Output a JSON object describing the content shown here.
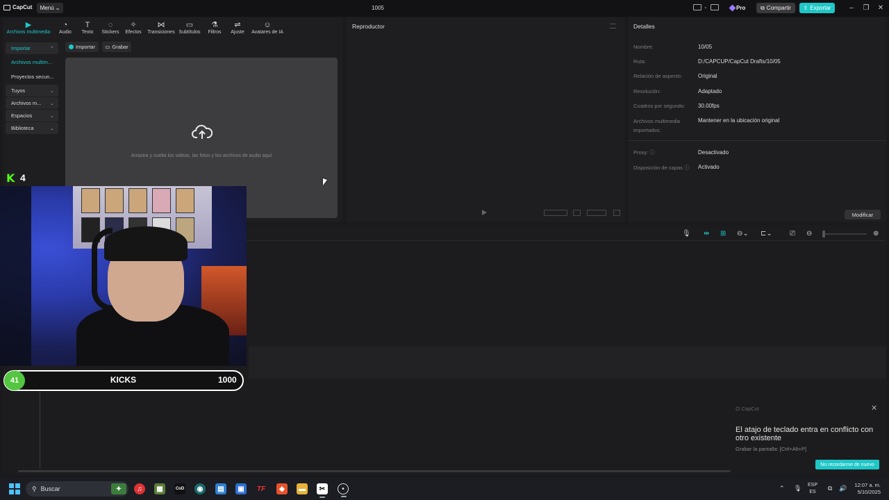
{
  "titlebar": {
    "brand": "CapCut",
    "menu_label": "Menú",
    "project_title": "1005",
    "pro_label": "Pro",
    "share_label": "Compartir",
    "export_label": "Exportar"
  },
  "tool_tabs": [
    {
      "label": "Archivos multimedia",
      "icon": "media-icon",
      "glyph": "▶"
    },
    {
      "label": "Audio",
      "icon": "audio-icon",
      "glyph": "◔"
    },
    {
      "label": "Texto",
      "icon": "text-icon",
      "glyph": "T"
    },
    {
      "label": "Stickers",
      "icon": "sticker-icon",
      "glyph": "◌"
    },
    {
      "label": "Efectos",
      "icon": "effects-icon",
      "glyph": "✧"
    },
    {
      "label": "Transiciones",
      "icon": "transitions-icon",
      "glyph": "⋈"
    },
    {
      "label": "Subtítulos",
      "icon": "subtitles-icon",
      "glyph": "▭"
    },
    {
      "label": "Filtros",
      "icon": "filters-icon",
      "glyph": "⚗"
    },
    {
      "label": "Ajuste",
      "icon": "adjust-icon",
      "glyph": "⇌"
    },
    {
      "label": "Avatares de IA",
      "icon": "ai-avatar-icon",
      "glyph": "☺"
    }
  ],
  "sidebar": {
    "items": [
      {
        "label": "Importar",
        "chevron": "⌃"
      },
      {
        "label": "Archivos multim...",
        "chevron": ""
      },
      {
        "label": "Proyectos secun...",
        "chevron": ""
      },
      {
        "label": "Tuyos",
        "chevron": "⌄"
      },
      {
        "label": "Archivos m...",
        "chevron": "⌄"
      },
      {
        "label": "Espacios",
        "chevron": "⌄"
      },
      {
        "label": "Biblioteca",
        "chevron": "⌄"
      }
    ]
  },
  "media": {
    "import_label": "Importar",
    "record_label": "Grabar",
    "dropzone_text": "Arrastra y suelta los videos, las fotos y los archivos de audio aquí"
  },
  "player": {
    "title": "Reproductor"
  },
  "details": {
    "title": "Detalles",
    "rows": [
      {
        "label": "Nombre:",
        "value": "10/05"
      },
      {
        "label": "Ruta:",
        "value": "D:/CAPCUP/CapCut Drafts/10/05"
      },
      {
        "label": "Relación de aspecto:",
        "value": "Original"
      },
      {
        "label": "Resolución:",
        "value": "Adaptado"
      },
      {
        "label": "Cuadros por segundo:",
        "value": "30.00fps"
      },
      {
        "label": "Archivos multimedia importados:",
        "value": "Mantener en la ubicación original"
      }
    ],
    "rows2": [
      {
        "label": "Proxy: ⓘ",
        "value": "Desactivado"
      },
      {
        "label": "Disposición de capas ⓘ",
        "value": "Activado"
      }
    ],
    "modify_label": "Modificar"
  },
  "overlay": {
    "kick_count": "4",
    "kicks_badge": "41",
    "kicks_label": "KICKS",
    "kicks_goal": "1000"
  },
  "toast": {
    "brand": "CapCut",
    "message": "El atajo de teclado entra en conflicto con otro existente",
    "hint": "Grabar la pantalla: [Ctrl+Alt+P]",
    "button": "No recordarme de nuevo"
  },
  "taskbar": {
    "search_placeholder": "Buscar",
    "lang_top": "ESP",
    "lang_bottom": "ES",
    "time": "12:07 a. m.",
    "date": "5/10/2025"
  },
  "colors": {
    "accent": "#1fc7c7",
    "kick_green": "#53fc18",
    "background": "#1a1a1c"
  }
}
